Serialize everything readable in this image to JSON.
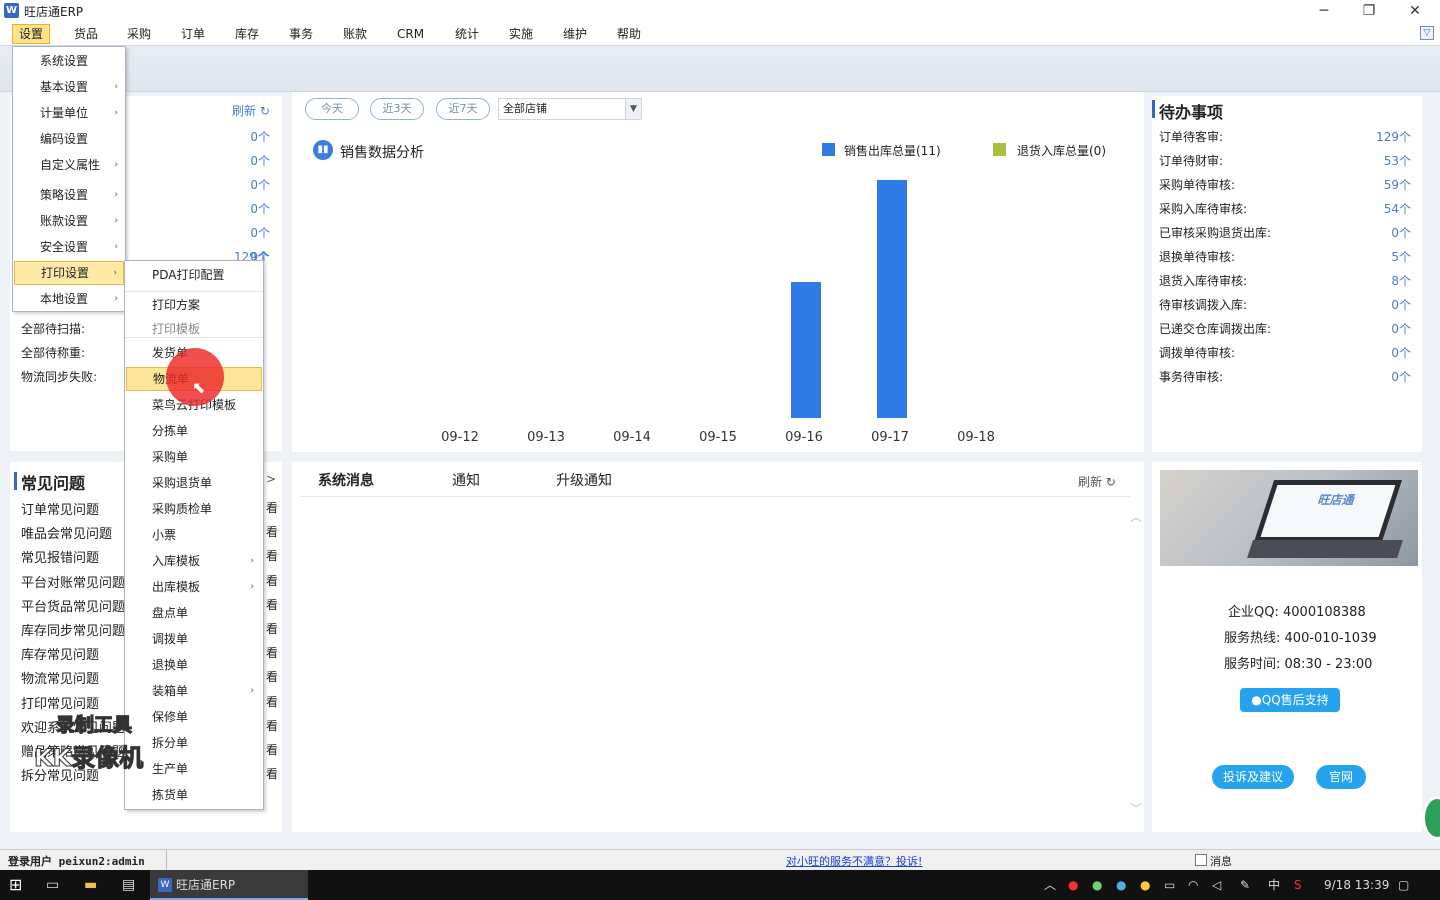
{
  "app": {
    "title": "旺店通ERP"
  },
  "window": {
    "minimize": "─",
    "restore": "❐",
    "close": "✕"
  },
  "menu": [
    "设置",
    "货品",
    "采购",
    "订单",
    "库存",
    "事务",
    "账款",
    "CRM",
    "统计",
    "实施",
    "维护",
    "帮助"
  ],
  "left_panel": {
    "refresh": "刷新",
    "counts": [
      "0个",
      "0个",
      "0个",
      "0个",
      "0个",
      "0个",
      "129个"
    ],
    "rows": [
      {
        "label": "全部待扫描:",
        "value": ""
      },
      {
        "label": "全部待称重:",
        "value": ""
      },
      {
        "label": "物流同步失败:",
        "value": ""
      }
    ]
  },
  "settings_menu": {
    "items": [
      {
        "label": "系统设置",
        "arrow": false
      },
      {
        "label": "基本设置",
        "arrow": true
      },
      {
        "label": "计量单位",
        "arrow": true
      },
      {
        "label": "编码设置",
        "arrow": false
      },
      {
        "label": "自定义属性",
        "arrow": true
      },
      {
        "label": "策略设置",
        "arrow": true
      },
      {
        "label": "账款设置",
        "arrow": true
      },
      {
        "label": "安全设置",
        "arrow": true
      },
      {
        "label": "打印设置",
        "arrow": true,
        "selected": true
      },
      {
        "label": "本地设置",
        "arrow": true
      }
    ]
  },
  "print_submenu": {
    "items": [
      {
        "label": "PDA打印配置"
      },
      {
        "label": "打印方案"
      },
      {
        "label": "打印模板",
        "disabled": true
      },
      {
        "label": "发货单"
      },
      {
        "label": "物流单",
        "selected": true
      },
      {
        "label": "菜鸟云打印模板"
      },
      {
        "label": "分拣单"
      },
      {
        "label": "采购单"
      },
      {
        "label": "采购退货单"
      },
      {
        "label": "采购质检单"
      },
      {
        "label": "小票"
      },
      {
        "label": "入库模板",
        "arrow": true
      },
      {
        "label": "出库模板",
        "arrow": true
      },
      {
        "label": "盘点单"
      },
      {
        "label": "调拨单"
      },
      {
        "label": "退换单"
      },
      {
        "label": "装箱单",
        "arrow": true
      },
      {
        "label": "保修单"
      },
      {
        "label": "拆分单"
      },
      {
        "label": "生产单"
      },
      {
        "label": "拣货单"
      }
    ]
  },
  "filters": {
    "today": "今天",
    "last3": "近3天",
    "last7": "近7天",
    "store": "全部店铺"
  },
  "chart_data": {
    "type": "bar",
    "title": "销售数据分析",
    "categories": [
      "09-12",
      "09-13",
      "09-14",
      "09-15",
      "09-16",
      "09-17",
      "09-18"
    ],
    "series": [
      {
        "name": "销售出库总量(11)",
        "values": [
          0,
          0,
          0,
          0,
          4,
          7,
          0
        ],
        "color": "#2f7be5"
      },
      {
        "name": "退货入库总量(0)",
        "values": [
          0,
          0,
          0,
          0,
          0,
          0,
          0
        ],
        "color": "#a8c03e"
      }
    ],
    "ylim": [
      0,
      7
    ],
    "grid": false,
    "legend": "top-right"
  },
  "todo": {
    "title": "待办事项",
    "items": [
      {
        "label": "订单待客审:",
        "value": "129个"
      },
      {
        "label": "订单待财审:",
        "value": "53个"
      },
      {
        "label": "采购单待审核:",
        "value": "59个"
      },
      {
        "label": "采购入库待审核:",
        "value": "54个"
      },
      {
        "label": "已审核采购退货出库:",
        "value": "0个"
      },
      {
        "label": "退换单待审核:",
        "value": "5个"
      },
      {
        "label": "退货入库待审核:",
        "value": "8个"
      },
      {
        "label": "待审核调拨入库:",
        "value": "0个"
      },
      {
        "label": "已递交仓库调拨出库:",
        "value": "0个"
      },
      {
        "label": "调拨单待审核:",
        "value": "0个"
      },
      {
        "label": "事务待审核:",
        "value": "0个"
      }
    ]
  },
  "faq": {
    "title": "常见问题",
    "more": ">",
    "see": "看",
    "items": [
      "订单常见问题",
      "唯品会常见问题",
      "常见报错问题",
      "平台对账常见问题",
      "平台货品常见问题",
      "库存同步常见问题",
      "库存常见问题",
      "物流常见问题",
      "打印常见问题",
      "欢迎系统常见问题",
      "赠品策略常见问题",
      "拆分常见问题"
    ]
  },
  "messages": {
    "tabs": [
      "系统消息",
      "通知",
      "升级通知"
    ],
    "refresh": "刷新"
  },
  "contact": {
    "promo_text": "旺店通",
    "qq_label": "企业QQ:",
    "qq": "4000108388",
    "hotline_label": "服务热线:",
    "hotline": "400-010-1039",
    "hours_label": "服务时间:",
    "hours": "08:30 - 23:00",
    "support_btn": "QQ售后支持",
    "complaint_btn": "投诉及建议",
    "site_btn": "官网"
  },
  "status": {
    "user": "登录用户 peixun2:admin",
    "feedback": "对小旺的服务不满意？投诉!",
    "messages": "消息"
  },
  "taskbar": {
    "app": "旺店通ERP",
    "ime": "中",
    "datetime": "9/18 13:39"
  },
  "watermark": {
    "line1": "录制工具",
    "line2": "KK录像机"
  }
}
